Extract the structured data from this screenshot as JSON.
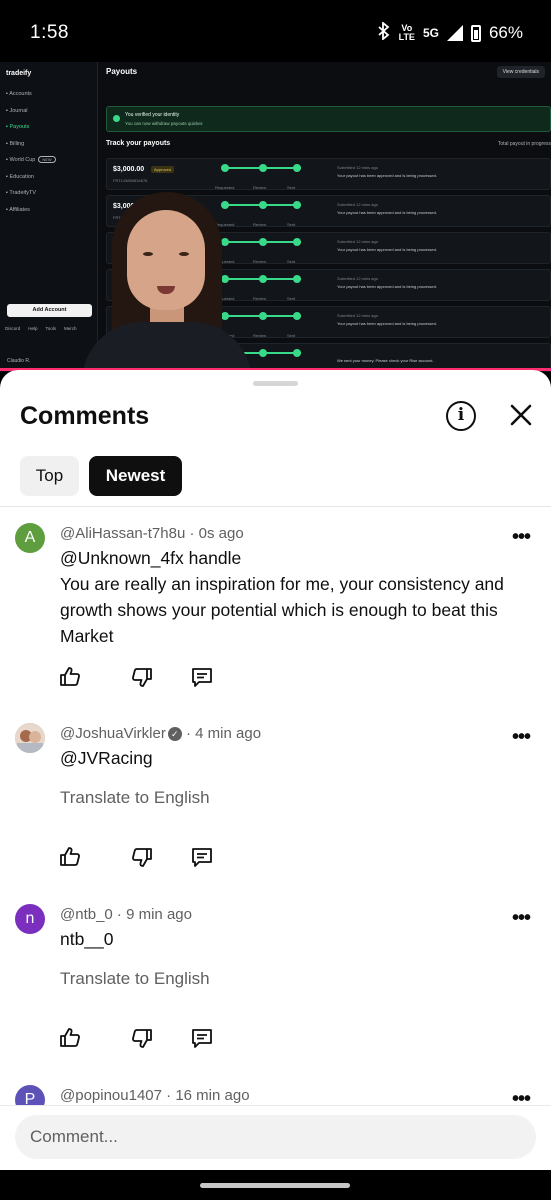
{
  "status_bar": {
    "time": "1:58",
    "network_top": "Vo",
    "network_bottom": "LTE",
    "network_gen": "5G",
    "battery": "66%"
  },
  "video": {
    "app_name": "tradeify",
    "nav": [
      {
        "icon": "grid-icon",
        "label": "Accounts"
      },
      {
        "icon": "pen-icon",
        "label": "Journal"
      },
      {
        "icon": "payouts-icon",
        "label": "Payouts"
      },
      {
        "icon": "billing-icon",
        "label": "Billing"
      },
      {
        "icon": "globe-icon",
        "label": "World Cup"
      },
      {
        "icon": "education-icon",
        "label": "Education"
      },
      {
        "icon": "tv-icon",
        "label": "TradeifyTV"
      },
      {
        "icon": "affiliates-icon",
        "label": "Affiliates"
      }
    ],
    "new_badge": "NEW",
    "add_account": "Add Account",
    "footer_links": [
      "Discord",
      "Help",
      "Tools",
      "Merch"
    ],
    "user_name": "Claudio R.",
    "page_title": "Payouts",
    "view_credentials": "View credentials",
    "verify_title": "You verified your identity",
    "verify_sub": "You can now withdraw payouts quicker.",
    "track_title": "Track your payouts",
    "total_payout": "Total payout in progress",
    "payout_rows": [
      {
        "amount": "$3,000.00",
        "badge": "Approved",
        "id": "FRTL15850834676",
        "submitted": "Submitted 12 mins ago",
        "message": "Your payout has been approved and is being processed."
      },
      {
        "amount": "$3,000",
        "badge": "",
        "id": "FRTL",
        "submitted": "Submitted 12 mins ago",
        "message": "Your payout has been approved and is being processed."
      },
      {
        "amount": "$3,0",
        "badge": "",
        "id": "FRTL",
        "submitted": "Submitted 12 mins ago",
        "message": "Your payout has been approved and is being processed."
      },
      {
        "amount": "$3,0",
        "badge": "",
        "id": "FRTL",
        "submitted": "Submitted 12 mins ago",
        "message": "Your payout has been approved and is being processed."
      },
      {
        "amount": "$3,000",
        "badge": "",
        "id": "FRTL",
        "submitted": "Submitted 12 mins ago",
        "message": "Your payout has been approved and is being processed."
      },
      {
        "amount": "",
        "badge": "",
        "id": "",
        "submitted": "",
        "message": "We sent your money. Please check your Rise account."
      }
    ],
    "step_labels": [
      "Requested",
      "Review",
      "Sent"
    ]
  },
  "comments_sheet": {
    "title": "Comments",
    "info_icon": "info-icon",
    "close_icon": "close-icon",
    "sort_chips": [
      "Top",
      "Newest"
    ],
    "selected_chip": "Newest",
    "comments": [
      {
        "avatar_letter": "A",
        "avatar_color": "#5e9e3e",
        "author": "@AliHassan-t7h8u",
        "time": " · 0s ago",
        "text": "@Unknown_4fx handle\nYou are really an inspiration for me, your consistency and growth shows your potential which is enough to beat this Market",
        "translate": ""
      },
      {
        "avatar_letter": "",
        "avatar_color": "#c9a48a",
        "author": "@JoshuaVirkler",
        "verified": true,
        "time": " · 4 min ago",
        "text": "@JVRacing",
        "translate": "Translate to English"
      },
      {
        "avatar_letter": "n",
        "avatar_color": "#7b2fbf",
        "author": "@ntb_0",
        "time": " · 9 min ago",
        "text": "ntb__0",
        "translate": "Translate to English"
      },
      {
        "avatar_letter": "P",
        "avatar_color": "#5c52b8",
        "author": "@popinou1407",
        "time": " · 16 min ago",
        "text": "",
        "translate": ""
      }
    ],
    "more_label": "•••",
    "input_placeholder": "Comment..."
  }
}
